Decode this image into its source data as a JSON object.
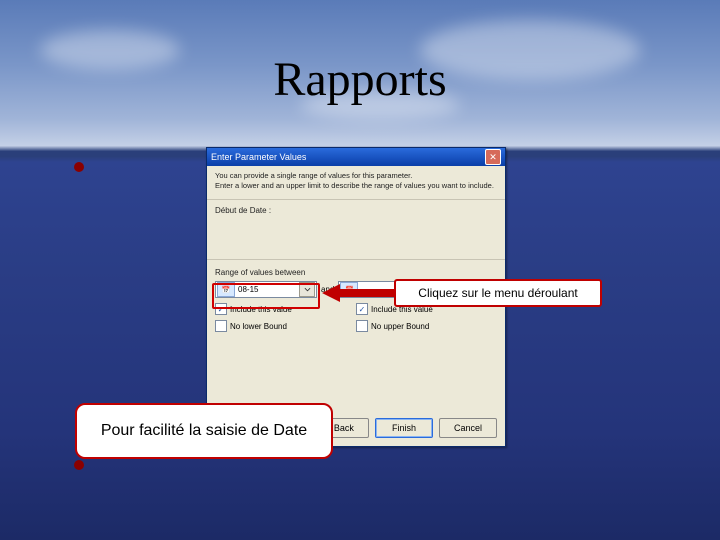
{
  "slide": {
    "title": "Rapports"
  },
  "dialog": {
    "title": "Enter Parameter Values",
    "instructions_line1": "You can provide a single range of values for this parameter.",
    "instructions_line2": "Enter a lower and an upper limit to describe the range of values you want to include.",
    "param_section_label": "Début de Date :",
    "range_label": "Range of values between",
    "start_value": "08-15",
    "and_label": "and",
    "end_value": "",
    "checkboxes": {
      "include_lower": {
        "label": "Include this value",
        "checked": true
      },
      "include_upper": {
        "label": "Include this value",
        "checked": true
      },
      "no_lower": {
        "label": "No lower Bound",
        "checked": false
      },
      "no_upper": {
        "label": "No upper Bound",
        "checked": false
      }
    },
    "buttons": {
      "back": "< Back",
      "finish": "Finish",
      "cancel": "Cancel"
    }
  },
  "callouts": {
    "dropdown_hint": "Cliquez sur le menu déroulant",
    "bottom_note": "Pour facilité la saisie de Date"
  }
}
